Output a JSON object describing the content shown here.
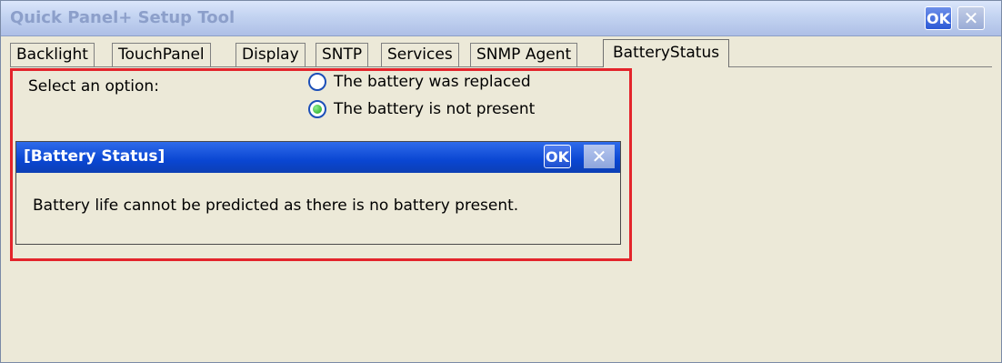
{
  "window": {
    "title": "Quick Panel+ Setup Tool",
    "ok_label": "OK",
    "close_label": "✕"
  },
  "tabs": [
    {
      "label": "Backlight"
    },
    {
      "label": "TouchPanel"
    },
    {
      "label": "Display"
    },
    {
      "label": "SNTP"
    },
    {
      "label": "Services"
    },
    {
      "label": "SNMP Agent"
    },
    {
      "label": "BatteryStatus",
      "active": true
    }
  ],
  "battery_panel": {
    "select_label": "Select an option:",
    "options": [
      {
        "label": "The battery was replaced",
        "checked": false
      },
      {
        "label": "The battery is not present",
        "checked": true
      }
    ]
  },
  "dialog": {
    "title": "[Battery Status]",
    "ok_label": "OK",
    "close_label": "✕",
    "message": "Battery life cannot be predicted as there is no battery present."
  },
  "colors": {
    "highlight_frame": "#e3242b",
    "dialog_titlebar": "#0a46d2",
    "window_background": "#ece9d8"
  }
}
